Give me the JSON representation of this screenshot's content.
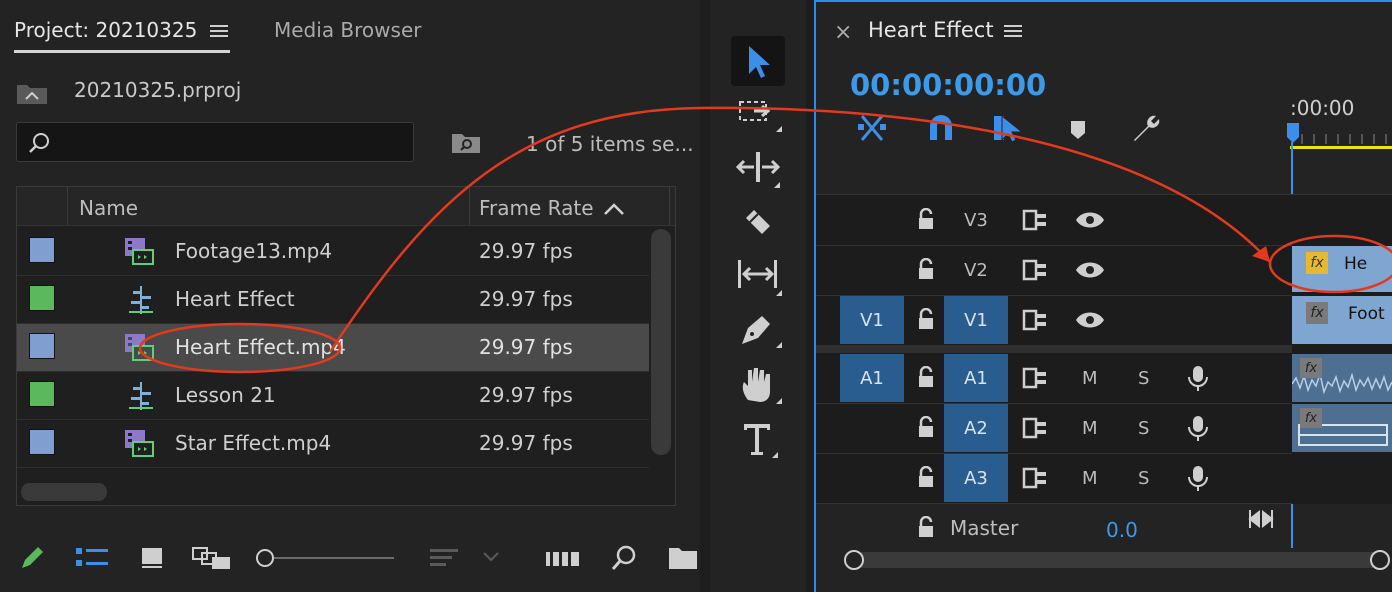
{
  "colors": {
    "accent": "#2d8ceb",
    "timecode": "#3d9ae8",
    "annotation": "#e23a1e",
    "playhead_bar": "#e8e800",
    "video_clip": "#7fa6d1",
    "sequence_swatch": "#5cb85c",
    "clip_swatch": "#7f9fd1"
  },
  "project": {
    "tab_project": "Project: 20210325",
    "tab_media": "Media Browser",
    "file_name": "20210325.prproj",
    "search_placeholder": "",
    "items_count": "1 of 5 items se...",
    "col_name": "Name",
    "col_rate": "Frame Rate",
    "rows": [
      {
        "name": "Footage13.mp4",
        "rate": "29.97 fps",
        "kind": "clip-icon",
        "swatch": "#7f9fd1"
      },
      {
        "name": "Heart Effect",
        "rate": "29.97 fps",
        "kind": "sequence-icon",
        "swatch": "#5cb85c"
      },
      {
        "name": "Heart Effect.mp4",
        "rate": "29.97 fps",
        "kind": "clip-icon",
        "swatch": "#7f9fd1"
      },
      {
        "name": "Lesson 21",
        "rate": "29.97 fps",
        "kind": "sequence-icon",
        "swatch": "#5cb85c"
      },
      {
        "name": "Star Effect.mp4",
        "rate": "29.97 fps",
        "kind": "clip-icon",
        "swatch": "#7f9fd1"
      }
    ]
  },
  "timeline": {
    "close": "×",
    "title": "Heart Effect",
    "timecode": "00:00:00:00",
    "ruler_time": ":00:00",
    "tracks": {
      "v3": "V3",
      "v2": "V2",
      "v1_src": "V1",
      "v1": "V1",
      "a1_src": "A1",
      "a1": "A1",
      "a2": "A2",
      "a3": "A3",
      "m": "M",
      "s": "S",
      "master": "Master",
      "master_value": "0.0"
    },
    "clips": {
      "v2_label": "He",
      "v1_label": "Foot",
      "fx": "fx"
    }
  }
}
